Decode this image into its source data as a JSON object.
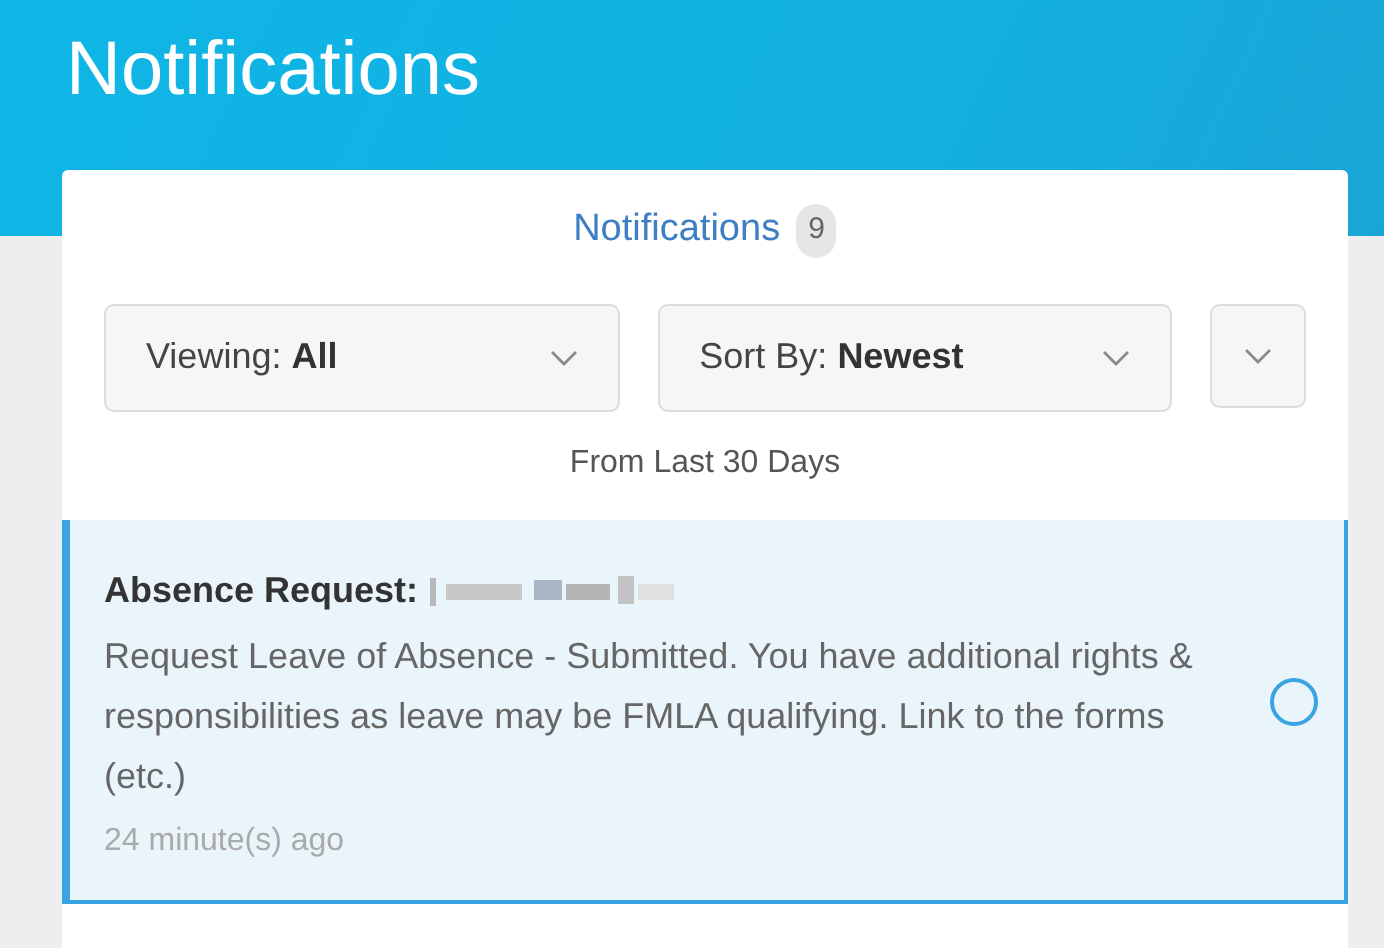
{
  "header": {
    "title": "Notifications"
  },
  "panel": {
    "title": "Notifications",
    "count": "9",
    "filters": [
      {
        "label": "Viewing:",
        "value": "All"
      },
      {
        "label": "Sort By:",
        "value": "Newest"
      }
    ],
    "range": "From Last 30 Days"
  },
  "notifications": [
    {
      "title": "Absence Request:",
      "body": "Request Leave of Absence - Submitted. You have additional rights & responsibilities as leave may be FMLA qualifying. Link to the forms (etc.)",
      "time": "24 minute(s) ago",
      "selected": true,
      "read": false
    }
  ]
}
